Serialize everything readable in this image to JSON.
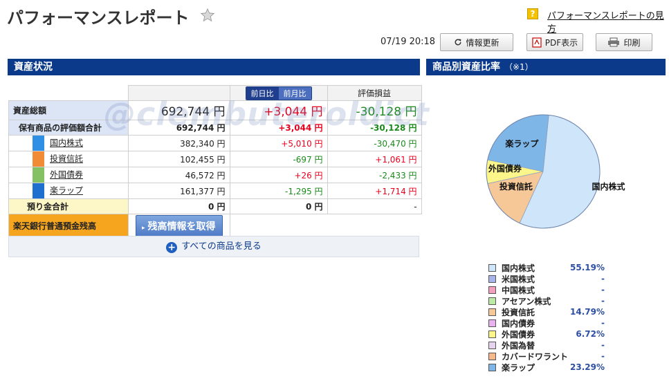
{
  "header": {
    "title": "パフォーマンスレポート",
    "help_icon": "?",
    "help_link": "パフォーマンスレポートの見方"
  },
  "toolbar": {
    "timestamp": "07/19 20:18",
    "refresh_label": "情報更新",
    "pdf_label": "PDF表示",
    "print_label": "印刷"
  },
  "sections": {
    "assets_title": "資産状況",
    "ratio_title": "商品別資産比率",
    "ratio_note": "（※1）"
  },
  "table": {
    "tab_day": "前日比",
    "tab_month": "前月比",
    "col_profit": "評価損益",
    "total": {
      "label": "資産総額",
      "value": "692,744 円",
      "change": "+3,044 円",
      "profit": "-30,128 円"
    },
    "subtotal": {
      "label": "保有商品の評価額合計",
      "value": "692,744 円",
      "change": "+3,044 円",
      "profit": "-30,128 円"
    },
    "items": [
      {
        "label": "国内株式",
        "value": "382,340 円",
        "change": "+5,010 円",
        "profit": "-30,470 円",
        "color": "#2f8fe4"
      },
      {
        "label": "投資信託",
        "value": "102,455 円",
        "change": "-697 円",
        "profit": "+1,061 円",
        "color": "#f28b35"
      },
      {
        "label": "外国債券",
        "value": "46,572 円",
        "change": "+26 円",
        "profit": "-2,433 円",
        "color": "#84c064"
      },
      {
        "label": "楽ラップ",
        "value": "161,377 円",
        "change": "-1,295 円",
        "profit": "+1,714 円",
        "color": "#1f6fd0"
      }
    ],
    "cash": {
      "label": "預り金合計",
      "value": "0 円",
      "change": "0 円",
      "profit": "-"
    },
    "bank": {
      "label": "楽天銀行普通預金残高",
      "button": "残高情報を取得"
    }
  },
  "all_products_label": "すべての商品を見る",
  "watermark": "@clembuteroldict",
  "chart_data": {
    "type": "pie",
    "slices": [
      {
        "label": "国内株式",
        "value": 55.19,
        "color": "#cfe6fa"
      },
      {
        "label": "投資信託",
        "value": 14.79,
        "color": "#f7c897"
      },
      {
        "label": "外国債券",
        "value": 6.72,
        "color": "#fbf58a"
      },
      {
        "label": "楽ラップ",
        "value": 23.29,
        "color": "#7fb6e8"
      }
    ]
  },
  "legend": [
    {
      "name": "国内株式",
      "value": "55.19%",
      "color": "#cfe6fa"
    },
    {
      "name": "米国株式",
      "value": "-",
      "color": "#a9b4ea"
    },
    {
      "name": "中国株式",
      "value": "-",
      "color": "#f3a0bf"
    },
    {
      "name": "アセアン株式",
      "value": "-",
      "color": "#bdeaa7"
    },
    {
      "name": "投資信託",
      "value": "14.79%",
      "color": "#f7c897"
    },
    {
      "name": "国内債券",
      "value": "-",
      "color": "#e8b2ee"
    },
    {
      "name": "外国債券",
      "value": "6.72%",
      "color": "#fbf58a"
    },
    {
      "name": "外国為替",
      "value": "-",
      "color": "#e6d3ef"
    },
    {
      "name": "カバードワラント",
      "value": "-",
      "color": "#f7b98b"
    },
    {
      "name": "楽ラップ",
      "value": "23.29%",
      "color": "#7fb6e8"
    }
  ]
}
